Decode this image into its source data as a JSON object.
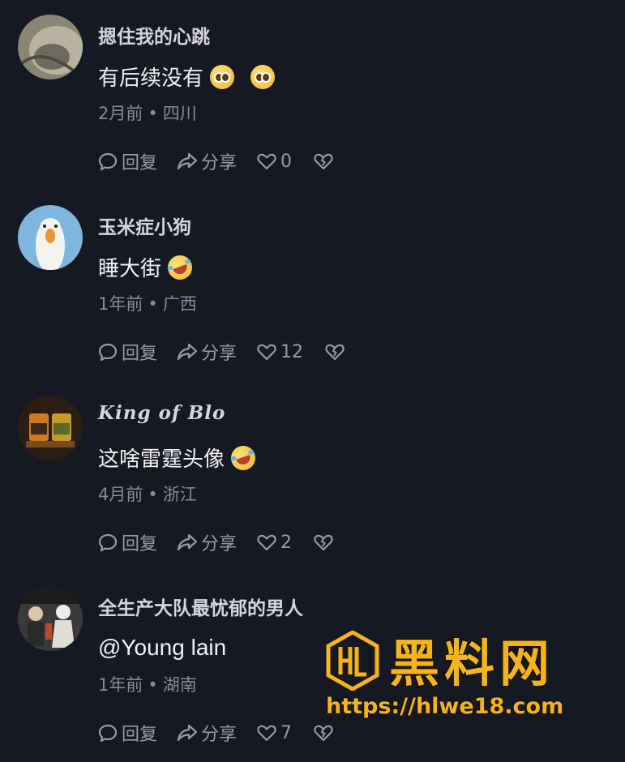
{
  "comments": [
    {
      "username": "摁住我的心跳",
      "text": "有后续没有",
      "emojis": [
        "pleading-face-emoji",
        "pleading-face-emoji"
      ],
      "time": "2月前",
      "location": "四川",
      "reply_label": "回复",
      "share_label": "分享",
      "likes": "0"
    },
    {
      "username": "玉米症小狗",
      "text": "睡大街",
      "emojis": [
        "rolling-laughing-emoji"
      ],
      "time": "1年前",
      "location": "广西",
      "reply_label": "回复",
      "share_label": "分享",
      "likes": "12"
    },
    {
      "username": "King of Blo",
      "text": "这啥雷霆头像",
      "emojis": [
        "rolling-laughing-emoji"
      ],
      "time": "4月前",
      "location": "浙江",
      "reply_label": "回复",
      "share_label": "分享",
      "likes": "2"
    },
    {
      "username": "全生产大队最忧郁的男人",
      "text": "@Young lain",
      "emojis": [],
      "time": "1年前",
      "location": "湖南",
      "reply_label": "回复",
      "share_label": "分享",
      "likes": "7"
    }
  ],
  "separator": "•",
  "watermark": {
    "title": "黑料网",
    "url": "https://hlwe18.com"
  },
  "colors": {
    "background": "#161823",
    "secondary_text": "#8a8b91",
    "watermark_accent": "#f6b418"
  }
}
